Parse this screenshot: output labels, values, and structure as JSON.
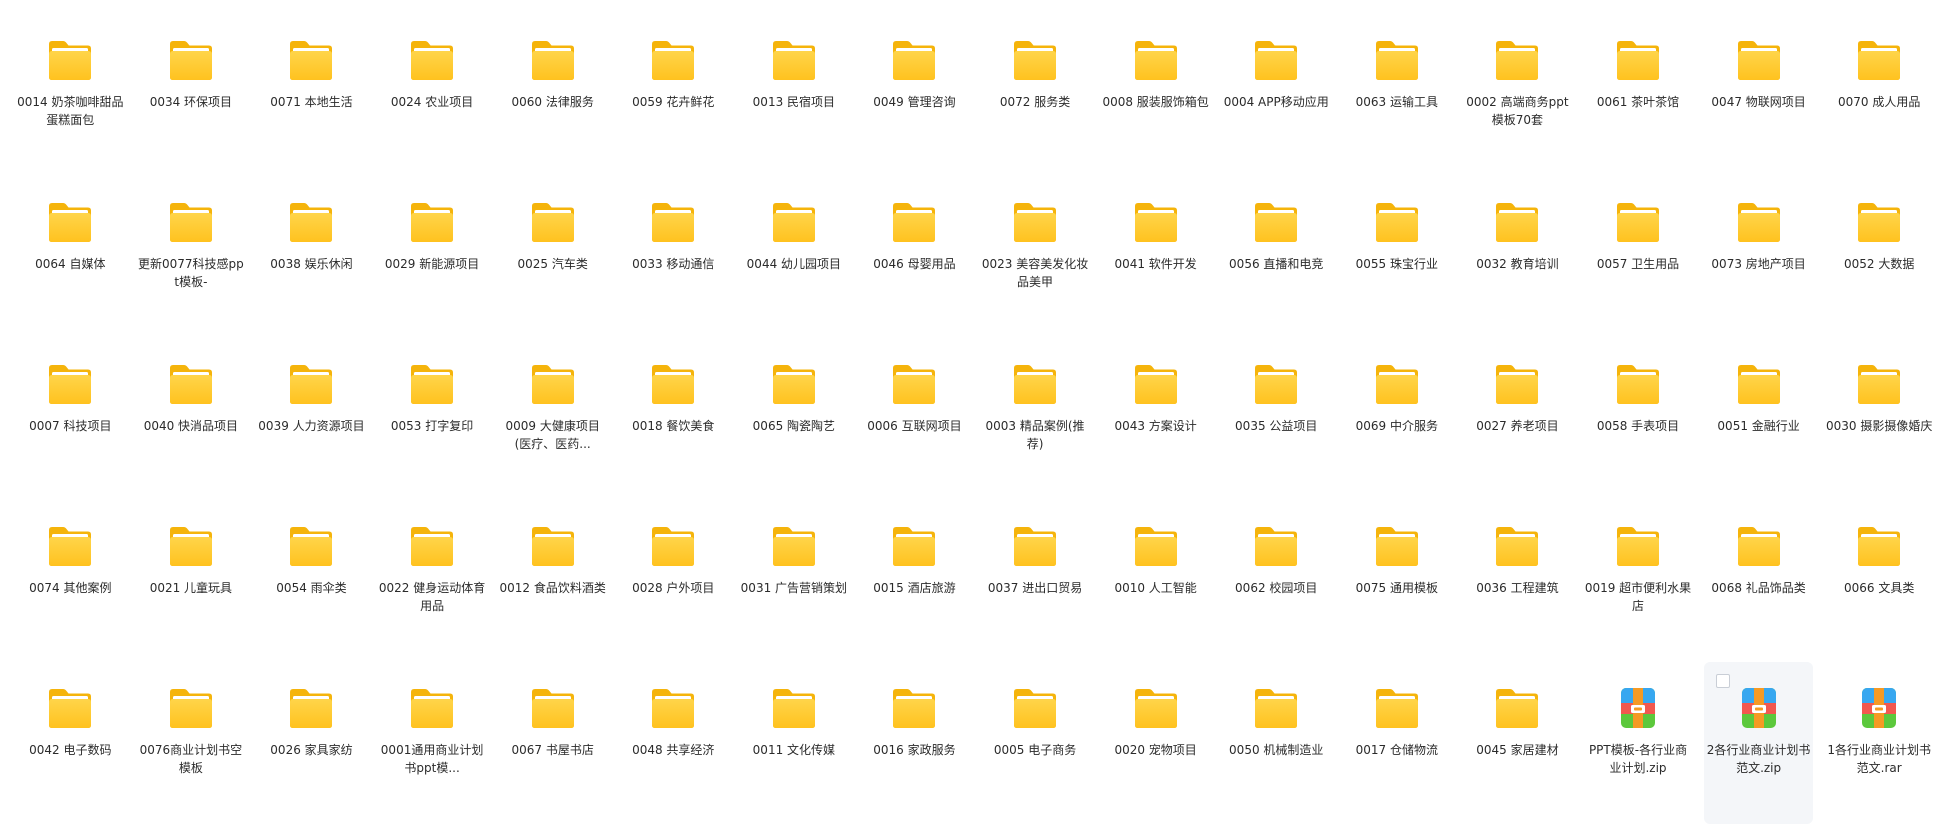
{
  "items": [
    {
      "name": "0014 奶茶咖啡甜品蛋糕面包",
      "type": "folder"
    },
    {
      "name": "0034 环保项目",
      "type": "folder"
    },
    {
      "name": "0071 本地生活",
      "type": "folder"
    },
    {
      "name": "0024 农业项目",
      "type": "folder"
    },
    {
      "name": "0060 法律服务",
      "type": "folder"
    },
    {
      "name": "0059 花卉鲜花",
      "type": "folder"
    },
    {
      "name": "0013 民宿项目",
      "type": "folder"
    },
    {
      "name": "0049 管理咨询",
      "type": "folder"
    },
    {
      "name": "0072 服务类",
      "type": "folder"
    },
    {
      "name": "0008 服装服饰箱包",
      "type": "folder"
    },
    {
      "name": "0004 APP移动应用",
      "type": "folder"
    },
    {
      "name": "0063 运输工具",
      "type": "folder"
    },
    {
      "name": "0002 高端商务ppt模板70套",
      "type": "folder"
    },
    {
      "name": "0061 茶叶茶馆",
      "type": "folder"
    },
    {
      "name": "0047 物联网项目",
      "type": "folder"
    },
    {
      "name": "0070 成人用品",
      "type": "folder"
    },
    {
      "name": "0064 自媒体",
      "type": "folder"
    },
    {
      "name": "更新0077科技感ppt模板-",
      "type": "folder"
    },
    {
      "name": "0038 娱乐休闲",
      "type": "folder"
    },
    {
      "name": "0029 新能源项目",
      "type": "folder"
    },
    {
      "name": "0025 汽车类",
      "type": "folder"
    },
    {
      "name": "0033 移动通信",
      "type": "folder"
    },
    {
      "name": "0044 幼儿园项目",
      "type": "folder"
    },
    {
      "name": "0046 母婴用品",
      "type": "folder"
    },
    {
      "name": "0023 美容美发化妆品美甲",
      "type": "folder"
    },
    {
      "name": "0041 软件开发",
      "type": "folder"
    },
    {
      "name": "0056 直播和电竞",
      "type": "folder"
    },
    {
      "name": "0055 珠宝行业",
      "type": "folder"
    },
    {
      "name": "0032 教育培训",
      "type": "folder"
    },
    {
      "name": "0057 卫生用品",
      "type": "folder"
    },
    {
      "name": "0073 房地产项目",
      "type": "folder"
    },
    {
      "name": "0052 大数据",
      "type": "folder"
    },
    {
      "name": "0007 科技项目",
      "type": "folder"
    },
    {
      "name": "0040 快消品项目",
      "type": "folder"
    },
    {
      "name": "0039 人力资源项目",
      "type": "folder"
    },
    {
      "name": "0053 打字复印",
      "type": "folder"
    },
    {
      "name": "0009 大健康项目(医疗、医药...",
      "type": "folder"
    },
    {
      "name": "0018 餐饮美食",
      "type": "folder"
    },
    {
      "name": "0065 陶瓷陶艺",
      "type": "folder"
    },
    {
      "name": "0006 互联网项目",
      "type": "folder"
    },
    {
      "name": "0003 精品案例(推荐)",
      "type": "folder"
    },
    {
      "name": "0043 方案设计",
      "type": "folder"
    },
    {
      "name": "0035 公益项目",
      "type": "folder"
    },
    {
      "name": "0069 中介服务",
      "type": "folder"
    },
    {
      "name": "0027 养老项目",
      "type": "folder"
    },
    {
      "name": "0058 手表项目",
      "type": "folder"
    },
    {
      "name": "0051 金融行业",
      "type": "folder"
    },
    {
      "name": "0030 摄影摄像婚庆",
      "type": "folder"
    },
    {
      "name": "0074 其他案例",
      "type": "folder"
    },
    {
      "name": "0021 儿童玩具",
      "type": "folder"
    },
    {
      "name": "0054 雨伞类",
      "type": "folder"
    },
    {
      "name": "0022 健身运动体育用品",
      "type": "folder"
    },
    {
      "name": "0012 食品饮料酒类",
      "type": "folder"
    },
    {
      "name": "0028 户外项目",
      "type": "folder"
    },
    {
      "name": "0031 广告营销策划",
      "type": "folder"
    },
    {
      "name": "0015 酒店旅游",
      "type": "folder"
    },
    {
      "name": "0037 进出口贸易",
      "type": "folder"
    },
    {
      "name": "0010 人工智能",
      "type": "folder"
    },
    {
      "name": "0062 校园项目",
      "type": "folder"
    },
    {
      "name": "0075 通用模板",
      "type": "folder"
    },
    {
      "name": "0036 工程建筑",
      "type": "folder"
    },
    {
      "name": "0019 超市便利水果店",
      "type": "folder"
    },
    {
      "name": "0068 礼品饰品类",
      "type": "folder"
    },
    {
      "name": "0066 文具类",
      "type": "folder"
    },
    {
      "name": "0042 电子数码",
      "type": "folder"
    },
    {
      "name": "0076商业计划书空模板",
      "type": "folder"
    },
    {
      "name": "0026 家具家纺",
      "type": "folder"
    },
    {
      "name": "0001通用商业计划书ppt模...",
      "type": "folder"
    },
    {
      "name": "0067 书屋书店",
      "type": "folder"
    },
    {
      "name": "0048 共享经济",
      "type": "folder"
    },
    {
      "name": "0011 文化传媒",
      "type": "folder"
    },
    {
      "name": "0016 家政服务",
      "type": "folder"
    },
    {
      "name": "0005 电子商务",
      "type": "folder"
    },
    {
      "name": "0020 宠物项目",
      "type": "folder"
    },
    {
      "name": "0050 机械制造业",
      "type": "folder"
    },
    {
      "name": "0017 仓储物流",
      "type": "folder"
    },
    {
      "name": "0045 家居建材",
      "type": "folder"
    },
    {
      "name": "PPT模板-各行业商业计划.zip",
      "type": "archive"
    },
    {
      "name": "2各行业商业计划书范文.zip",
      "type": "archive",
      "selected": true
    },
    {
      "name": "1各行业商业计划书范文.rar",
      "type": "archive"
    }
  ]
}
